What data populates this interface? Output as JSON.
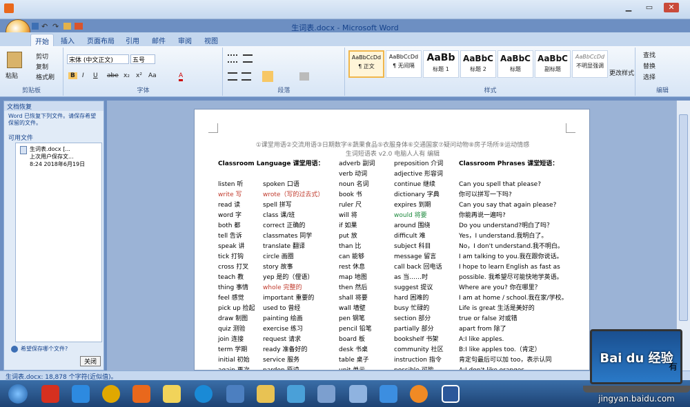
{
  "window": {
    "title": "生词表.docx - Microsoft Word",
    "controls": [
      "minimize",
      "restore",
      "close"
    ]
  },
  "qat": {
    "icons": [
      "save-icon",
      "undo-icon",
      "redo-icon",
      "open-icon",
      "custom-icon"
    ]
  },
  "tabs": [
    "开始",
    "插入",
    "页面布局",
    "引用",
    "邮件",
    "审阅",
    "视图"
  ],
  "ribbon": {
    "clipboard": {
      "label": "剪贴板",
      "paste": "粘贴",
      "cut": "剪切",
      "copy": "复制",
      "format_painter": "格式刷"
    },
    "font": {
      "label": "字体",
      "font_name": "宋体 (中文正文)",
      "font_size": "五号",
      "buttons": [
        "B",
        "I",
        "U",
        "abe",
        "x₂",
        "x²",
        "Aa",
        "A"
      ]
    },
    "paragraph": {
      "label": "段落"
    },
    "styles": {
      "label": "样式",
      "items": [
        {
          "preview": "AaBbCcDd",
          "name": "¶ 正文"
        },
        {
          "preview": "AaBbCcDd",
          "name": "¶ 无间隔"
        },
        {
          "preview": "AaBb",
          "name": "标题 1"
        },
        {
          "preview": "AaBbC",
          "name": "标题 2"
        },
        {
          "preview": "AaBbC",
          "name": "标题"
        },
        {
          "preview": "AaBbC",
          "name": "副标题"
        },
        {
          "preview": "AaBbCcDd",
          "name": "不明显强调"
        }
      ],
      "change": "更改样式"
    },
    "editing": {
      "label": "编辑",
      "find": "查找",
      "replace": "替换",
      "select": "选择"
    }
  },
  "recovery_pane": {
    "title": "文档恢复",
    "message": "Word 已恢复下列文件。请保存希望保留的文件。",
    "available": "可用文件",
    "file_name": "生词表.docx [...",
    "file_status": "上次用户保存文...",
    "file_time": "8:24 2018年6月19日",
    "question": "希望保存哪个文件?",
    "close": "关闭"
  },
  "document": {
    "header1": "①课堂用语②交流用语③日期数字④蔬果食品⑤衣服身体⑥交通国家⑦疑问动物⑧房子场所⑨运动情感",
    "header2": "生词短语表 v2.0 电脑人人有 编辑",
    "col1": [
      "Classroom Language 课堂用语：",
      "",
      "listen 听",
      "write 写",
      "read 读",
      "word 字",
      "both 都",
      "tell 告诉",
      "speak 讲",
      "tick 打钩",
      "cross 打叉",
      "teach 教",
      "thing 事情",
      "feel 感觉",
      "pick up 捡起",
      "draw 制图",
      "quiz 测验",
      "join 连接",
      "term 学期",
      "initial 初始",
      "again 再次"
    ],
    "col2": [
      "",
      "",
      "spoken 口语",
      "wrote（写的过去式）",
      "spell 拼写",
      "class 课/班",
      "correct 正确的",
      "classmates 同学",
      "translate 翻译",
      "circle 画圈",
      "story 故事",
      "yep 是的（俚语）",
      "whole 完整的",
      "important 重要的",
      "used to 曾经",
      "painting 绘画",
      "exercise 练习",
      "request 请求",
      "ready 准备好的",
      "service 服务",
      "pardon 原谅"
    ],
    "col3": [
      "adverb 副词",
      "verb 动词",
      "noun 名词",
      "book 书",
      "ruler 尺",
      "will 将",
      "if 如果",
      "put 放",
      "than 比",
      "can 能够",
      "rest 休息",
      "map 地图",
      "then 然后",
      "shall 将要",
      "wall 墙壁",
      "pen 钢笔",
      "pencil 铅笔",
      "board 板",
      "desk 书桌",
      "table 桌子",
      "unit 单元"
    ],
    "col4": [
      "preposition 介词",
      "adjective 形容词",
      "continue 继续",
      "dictionary 字典",
      "expires 到期",
      "would 将要",
      "around 围绕",
      "difficult 难",
      "subject 科目",
      "message 留言",
      "call back 回电话",
      "as 当……时",
      "suggest 提议",
      "hard 困难的",
      "busy 忙碌的",
      "section 部分",
      "partially 部分",
      "bookshelf 书架",
      "community 社区",
      "instruction 指令",
      "possible 可能"
    ],
    "col5": [
      "Classroom Phrases 课堂短语：",
      "",
      "Can you spell that please?",
      "你可以拼写一下吗?",
      "Can you say that again please?",
      "你能再说一遍吗?",
      "Do you understand?明白了吗？",
      "Yes，I understand.我明白了。",
      "No，I don't understand.我不明白。",
      "I am talking to you.我在跟你说话。",
      "I hope to learn English as fast as",
      "possible. 我希望尽可能快地学英语。",
      "Where are you? 你在哪里？",
      "I am at home / school.我在家/学校。",
      "Life is great 生活是美好的",
      "true or false 对或错",
      "apart from 除了",
      "A:I like apples.",
      "B:I like apples too.（肯定）",
      "肯定句最后可以加 too，表示认同",
      "A:I don't like oranges."
    ]
  },
  "status": {
    "text": "生词表.docx: 18,878 个字符(近似值)。"
  },
  "watermark": {
    "brand": "Bai du 经验",
    "url": "jingyan.baidu.com",
    "badge": "有"
  },
  "colors": {
    "ribbon": "#dbe7f5",
    "accent": "#15428b",
    "highlight_red": "#c0392b",
    "highlight_green": "#1e8a3e"
  }
}
